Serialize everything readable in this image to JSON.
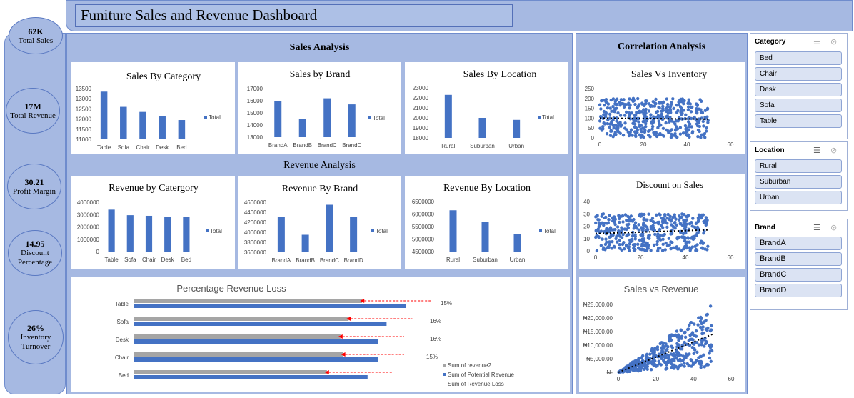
{
  "title": "Funiture Sales and Revenue Dashboard",
  "kpis": [
    {
      "value": "62K",
      "label": "Total Sales"
    },
    {
      "value": "17M",
      "label": "Total Revenue"
    },
    {
      "value": "30.21",
      "label": "Profit Margin"
    },
    {
      "value": "14.95",
      "label": "Discount Percentage"
    },
    {
      "value": "26%",
      "label": "Inventory Turnover"
    }
  ],
  "sections": {
    "sales": "Sales Analysis",
    "revenue": "Revenue Analysis",
    "correlation": "Correlation Analysis"
  },
  "colors": {
    "bar": "#4472c4",
    "panel": "#a6b9e2",
    "gray": "#a5a5a5",
    "arrow": "#ff0000"
  },
  "chart_data": [
    {
      "id": "sales_category",
      "type": "bar",
      "title": "Sales By Category",
      "categories": [
        "Table",
        "Sofa",
        "Chair",
        "Desk",
        "Bed"
      ],
      "values": [
        13350,
        12600,
        12350,
        12150,
        11950
      ],
      "ylim": [
        11000,
        13500
      ],
      "yticks": [
        "13500",
        "13000",
        "12500",
        "12000",
        "11500",
        "11000"
      ],
      "legend": "Total"
    },
    {
      "id": "sales_brand",
      "type": "bar",
      "title": "Sales by Brand",
      "categories": [
        "BrandA",
        "BrandB",
        "BrandC",
        "BrandD"
      ],
      "values": [
        16000,
        14500,
        16200,
        15700
      ],
      "ylim": [
        13000,
        17000
      ],
      "yticks": [
        "17000",
        "16000",
        "15000",
        "14000",
        "13000"
      ],
      "legend": "Total"
    },
    {
      "id": "sales_location",
      "type": "bar",
      "title": "Sales By Location",
      "categories": [
        "Rural",
        "Suburban",
        "Urban"
      ],
      "values": [
        22300,
        20000,
        19800
      ],
      "ylim": [
        18000,
        23000
      ],
      "yticks": [
        "23000",
        "22000",
        "21000",
        "20000",
        "19000",
        "18000"
      ],
      "legend": "Total"
    },
    {
      "id": "revenue_category",
      "type": "bar",
      "title": "Revenue by Catergory",
      "categories": [
        "Table",
        "Sofa",
        "Chair",
        "Desk",
        "Bed"
      ],
      "values": [
        3400000,
        2950000,
        2900000,
        2800000,
        2800000
      ],
      "ylim": [
        0,
        4000000
      ],
      "yticks": [
        "4000000",
        "3000000",
        "2000000",
        "1000000",
        "0"
      ],
      "legend": "Total"
    },
    {
      "id": "revenue_brand",
      "type": "bar",
      "title": "Revenue By Brand",
      "categories": [
        "BrandA",
        "BrandB",
        "BrandC",
        "BrandD"
      ],
      "values": [
        4300000,
        3950000,
        4550000,
        4300000
      ],
      "ylim": [
        3600000,
        4600000
      ],
      "yticks": [
        "4600000",
        "4400000",
        "4200000",
        "4000000",
        "3800000",
        "3600000"
      ],
      "legend": "Total"
    },
    {
      "id": "revenue_location",
      "type": "bar",
      "title": "Revenue By Location",
      "categories": [
        "Rural",
        "Suburban",
        "Urban"
      ],
      "values": [
        6150000,
        5700000,
        5200000
      ],
      "ylim": [
        4500000,
        6500000
      ],
      "yticks": [
        "6500000",
        "6000000",
        "5500000",
        "5000000",
        "4500000"
      ],
      "legend": "Total"
    },
    {
      "id": "revenue_loss",
      "type": "bar",
      "title": "Percentage Revenue Loss",
      "categories": [
        "Table",
        "Sofa",
        "Desk",
        "Chair",
        "Bed"
      ],
      "series": [
        {
          "name": "Sum of revenue2",
          "values": [
            0.84,
            0.79,
            0.76,
            0.77,
            0.71
          ]
        },
        {
          "name": "Sum of Potential Revenue",
          "values": [
            1.0,
            0.93,
            0.9,
            0.9,
            0.86
          ]
        },
        {
          "name": "Sum of Revenue Loss",
          "values": [
            0.15,
            0.16,
            0.16,
            0.15,
            0.14
          ]
        }
      ],
      "data_labels": [
        "15%",
        "16%",
        "16%",
        "15%",
        ""
      ]
    },
    {
      "id": "sales_inventory",
      "type": "scatter",
      "title": "Sales Vs Inventory",
      "xlim": [
        0,
        60
      ],
      "ylim": [
        0,
        250
      ],
      "xticks": [
        "0",
        "20",
        "40",
        "60"
      ],
      "yticks": [
        "250",
        "200",
        "150",
        "100",
        "50",
        "0"
      ],
      "trend": [
        100,
        95
      ]
    },
    {
      "id": "discount_sales",
      "type": "scatter",
      "title": "Discount on Sales",
      "xlim": [
        0,
        60
      ],
      "ylim": [
        0,
        40
      ],
      "xticks": [
        "0",
        "20",
        "40",
        "60"
      ],
      "yticks": [
        "40",
        "30",
        "20",
        "10",
        "0"
      ],
      "trend": [
        14,
        17
      ]
    },
    {
      "id": "sales_revenue",
      "type": "scatter",
      "title": "Sales vs Revenue",
      "xlim": [
        0,
        60
      ],
      "ylim": [
        0,
        25000
      ],
      "xticks": [
        "0",
        "20",
        "40",
        "60"
      ],
      "yticks": [
        "₦25,000.00",
        "₦20,000.00",
        "₦15,000.00",
        "₦10,000.00",
        "₦5,000.00",
        "₦-"
      ],
      "trend": [
        0,
        14000
      ]
    }
  ],
  "slicers": {
    "category": {
      "title": "Category",
      "items": [
        "Bed",
        "Chair",
        "Desk",
        "Sofa",
        "Table"
      ]
    },
    "location": {
      "title": "Location",
      "items": [
        "Rural",
        "Suburban",
        "Urban"
      ]
    },
    "brand": {
      "title": "Brand",
      "items": [
        "BrandA",
        "BrandB",
        "BrandC",
        "BrandD"
      ]
    }
  },
  "icons": {
    "multiselect": "multi-select-icon",
    "clear": "clear-filter-icon"
  }
}
